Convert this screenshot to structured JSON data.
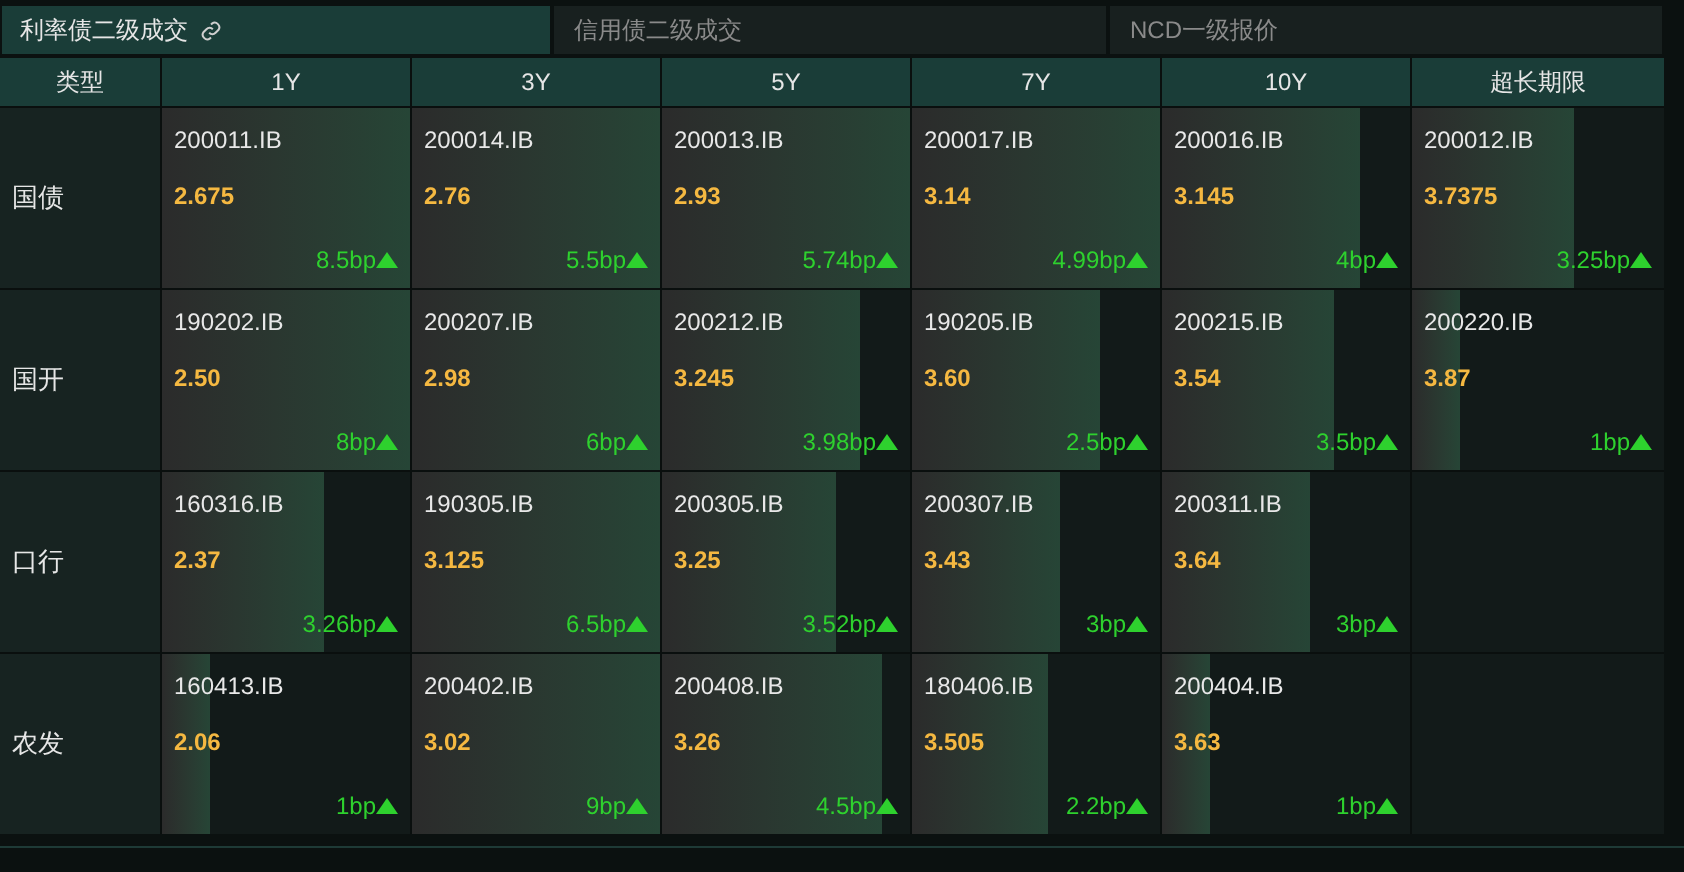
{
  "tabs": [
    {
      "label": "利率债二级成交",
      "selected": true,
      "linked": true
    },
    {
      "label": "信用债二级成交",
      "selected": false,
      "linked": false
    },
    {
      "label": "NCD一级报价",
      "selected": false,
      "linked": false
    }
  ],
  "table": {
    "columns": [
      "类型",
      "1Y",
      "3Y",
      "5Y",
      "7Y",
      "10Y",
      "超长期限"
    ],
    "rows": [
      {
        "cells": [
          {
            "kind": "type",
            "text": "国债"
          },
          {
            "kind": "bond",
            "code": "200011.IB",
            "yield": "2.675",
            "change": "8.5bp",
            "level": 1.0
          },
          {
            "kind": "bond",
            "code": "200014.IB",
            "yield": "2.76",
            "change": "5.5bp",
            "level": 1.0
          },
          {
            "kind": "bond",
            "code": "200013.IB",
            "yield": "2.93",
            "change": "5.74bp",
            "level": 1.0
          },
          {
            "kind": "bond",
            "code": "200017.IB",
            "yield": "3.14",
            "change": "4.99bp",
            "level": 1.0
          },
          {
            "kind": "bond",
            "code": "200016.IB",
            "yield": "3.145",
            "change": "4bp",
            "level": 0.8
          },
          {
            "kind": "bond",
            "code": "200012.IB",
            "yield": "3.7375",
            "change": "3.25bp",
            "level": 0.64
          }
        ]
      },
      {
        "cells": [
          {
            "kind": "type",
            "text": "国开"
          },
          {
            "kind": "bond",
            "code": "190202.IB",
            "yield": "2.50",
            "change": "8bp",
            "level": 1.0
          },
          {
            "kind": "bond",
            "code": "200207.IB",
            "yield": "2.98",
            "change": "6bp",
            "level": 1.0
          },
          {
            "kind": "bond",
            "code": "200212.IB",
            "yield": "3.245",
            "change": "3.98bp",
            "level": 0.8
          },
          {
            "kind": "bond",
            "code": "190205.IB",
            "yield": "3.60",
            "change": "2.5bp",
            "level": 0.76
          },
          {
            "kind": "bond",
            "code": "200215.IB",
            "yield": "3.54",
            "change": "3.5bp",
            "level": 0.69
          },
          {
            "kind": "bond",
            "code": "200220.IB",
            "yield": "3.87",
            "change": "1bp",
            "level": 0.19
          }
        ]
      },
      {
        "cells": [
          {
            "kind": "type",
            "text": "口行"
          },
          {
            "kind": "bond",
            "code": "160316.IB",
            "yield": "2.37",
            "change": "3.26bp",
            "level": 0.65
          },
          {
            "kind": "bond",
            "code": "190305.IB",
            "yield": "3.125",
            "change": "6.5bp",
            "level": 1.0
          },
          {
            "kind": "bond",
            "code": "200305.IB",
            "yield": "3.25",
            "change": "3.52bp",
            "level": 0.7
          },
          {
            "kind": "bond",
            "code": "200307.IB",
            "yield": "3.43",
            "change": "3bp",
            "level": 0.6
          },
          {
            "kind": "bond",
            "code": "200311.IB",
            "yield": "3.64",
            "change": "3bp",
            "level": 0.6
          }
        ]
      },
      {
        "cells": [
          {
            "kind": "type",
            "text": "农发"
          },
          {
            "kind": "bond",
            "code": "160413.IB",
            "yield": "2.06",
            "change": "1bp",
            "level": 0.19
          },
          {
            "kind": "bond",
            "code": "200402.IB",
            "yield": "3.02",
            "change": "9bp",
            "level": 1.0
          },
          {
            "kind": "bond",
            "code": "200408.IB",
            "yield": "3.26",
            "change": "4.5bp",
            "level": 0.89
          },
          {
            "kind": "bond",
            "code": "180406.IB",
            "yield": "3.505",
            "change": "2.2bp",
            "level": 0.55
          },
          {
            "kind": "bond",
            "code": "200404.IB",
            "yield": "3.63",
            "change": "1bp",
            "level": 0.19
          }
        ]
      }
    ]
  }
}
